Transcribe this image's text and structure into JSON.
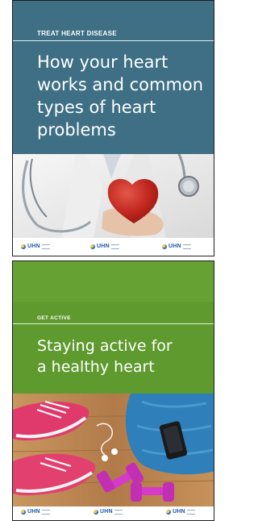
{
  "cards": [
    {
      "category": "TREAT HEART DISEASE",
      "title_lines": [
        "How your heart",
        "works and common",
        "types of heart",
        "problems"
      ],
      "logos": [
        "UHN",
        "UHN",
        "UHN"
      ],
      "colors": {
        "header": "#3e6f85"
      }
    },
    {
      "category": "GET ACTIVE",
      "title_lines": [
        "Staying active for",
        "a healthy heart"
      ],
      "logos": [
        "UHN",
        "UHN",
        "UHN"
      ],
      "colors": {
        "header": "#5e9a2e"
      }
    }
  ]
}
